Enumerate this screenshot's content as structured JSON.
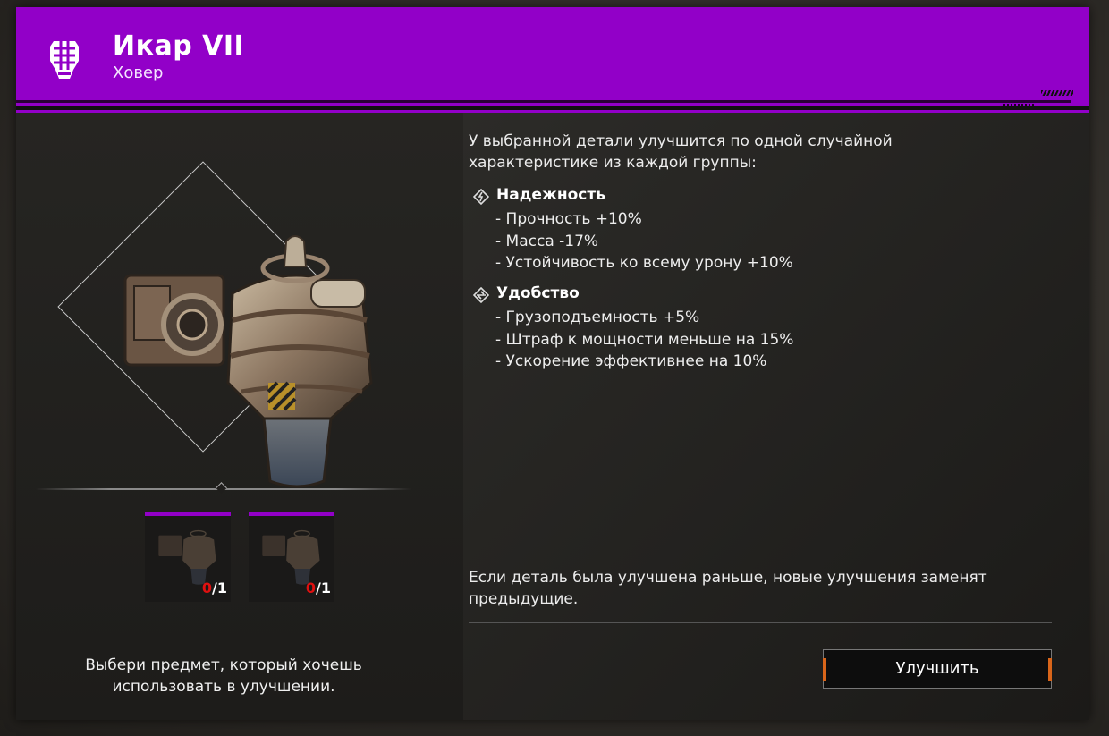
{
  "header": {
    "title": "Икар VII",
    "subtitle": "Ховер",
    "icon": "hover-icon",
    "accent": "#9200c8"
  },
  "item": {
    "icon": "hover-part-image"
  },
  "slots": [
    {
      "have": "0",
      "sep": "/",
      "need": "1"
    },
    {
      "have": "0",
      "sep": "/",
      "need": "1"
    }
  ],
  "hint": "Выбери предмет, который хочешь использовать в улучшении.",
  "intro": "У выбранной детали улучшится по одной случайной характеристике из каждой группы:",
  "groups": [
    {
      "title": "Надежность",
      "icon": "reliability-icon",
      "stats": [
        "- Прочность +10%",
        "- Масса -17%",
        "- Устойчивость ко всему урону +10%"
      ]
    },
    {
      "title": "Удобство",
      "icon": "convenience-icon",
      "stats": [
        "- Грузоподъемность +5%",
        "- Штраф к мощности меньше на 15%",
        "- Ускорение эффективнее на 10%"
      ]
    }
  ],
  "note": "Если деталь была улучшена раньше, новые улучшения заменят предыдущие.",
  "upgrade_button": "Улучшить",
  "button_accent": "#d8651a"
}
